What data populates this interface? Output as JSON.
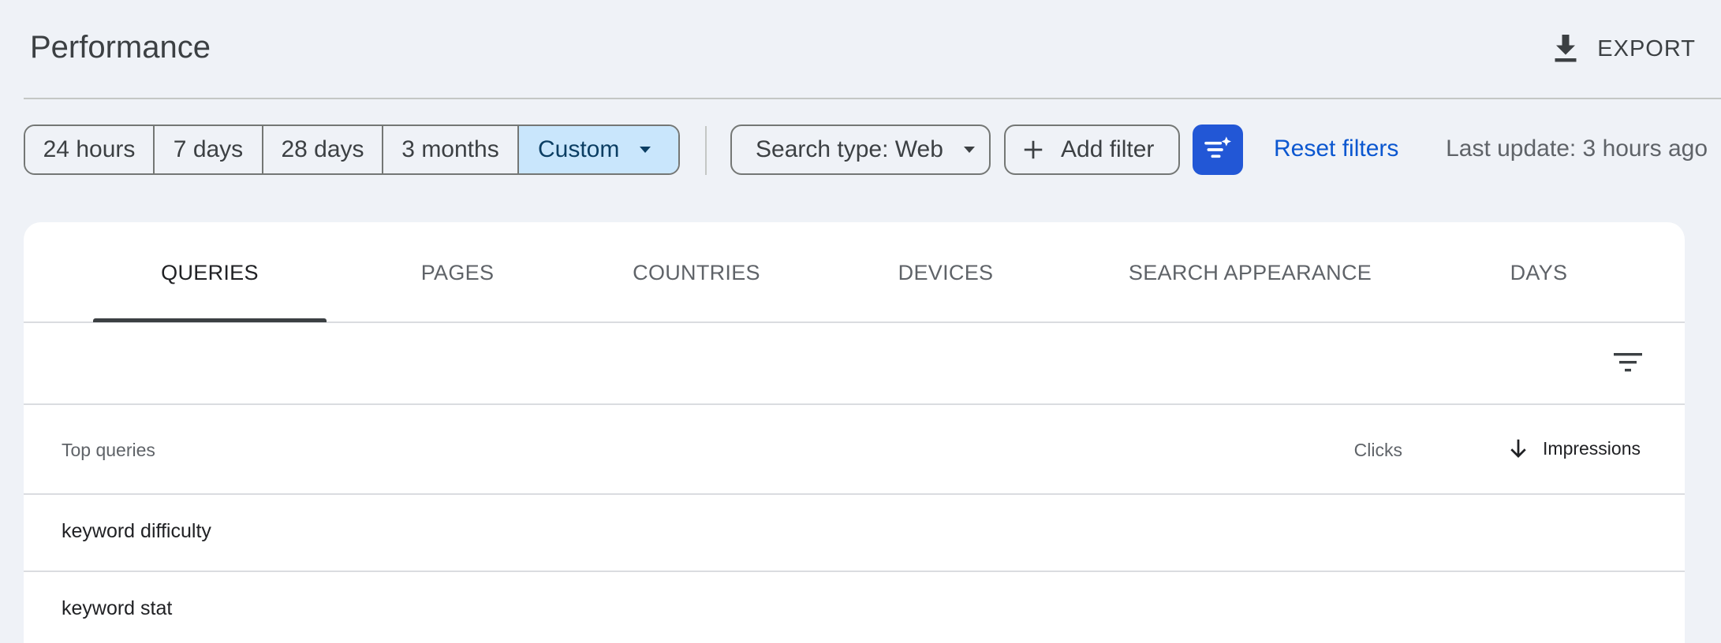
{
  "header": {
    "title": "Performance",
    "export_label": "EXPORT"
  },
  "date_range": {
    "options": [
      "24 hours",
      "7 days",
      "28 days",
      "3 months",
      "Custom"
    ],
    "selected": "Custom"
  },
  "filters": {
    "search_type_label": "Search type: Web",
    "add_filter_label": "Add filter",
    "reset_label": "Reset filters",
    "last_update": "Last update: 3 hours ago"
  },
  "tabs": [
    {
      "label": "QUERIES",
      "active": true
    },
    {
      "label": "PAGES",
      "active": false
    },
    {
      "label": "COUNTRIES",
      "active": false
    },
    {
      "label": "DEVICES",
      "active": false
    },
    {
      "label": "SEARCH APPEARANCE",
      "active": false
    },
    {
      "label": "DAYS",
      "active": false
    }
  ],
  "table": {
    "columns": [
      "Top queries",
      "Clicks",
      "Impressions"
    ],
    "sort_column": "Impressions",
    "sort_direction": "descending",
    "rows": [
      {
        "query": "keyword difficulty"
      },
      {
        "query": "keyword stat"
      }
    ]
  },
  "colors": {
    "background": "#eff2f7",
    "selected_segment": "#c9e6fc",
    "accent_button": "#2257d6",
    "link": "#0b57d0"
  },
  "icons": {
    "export": "download-icon",
    "add_filter": "plus-icon",
    "ai_filter": "filter-sparkle-icon",
    "table_filter": "filter-rows-icon",
    "sort": "arrow-down-icon"
  }
}
